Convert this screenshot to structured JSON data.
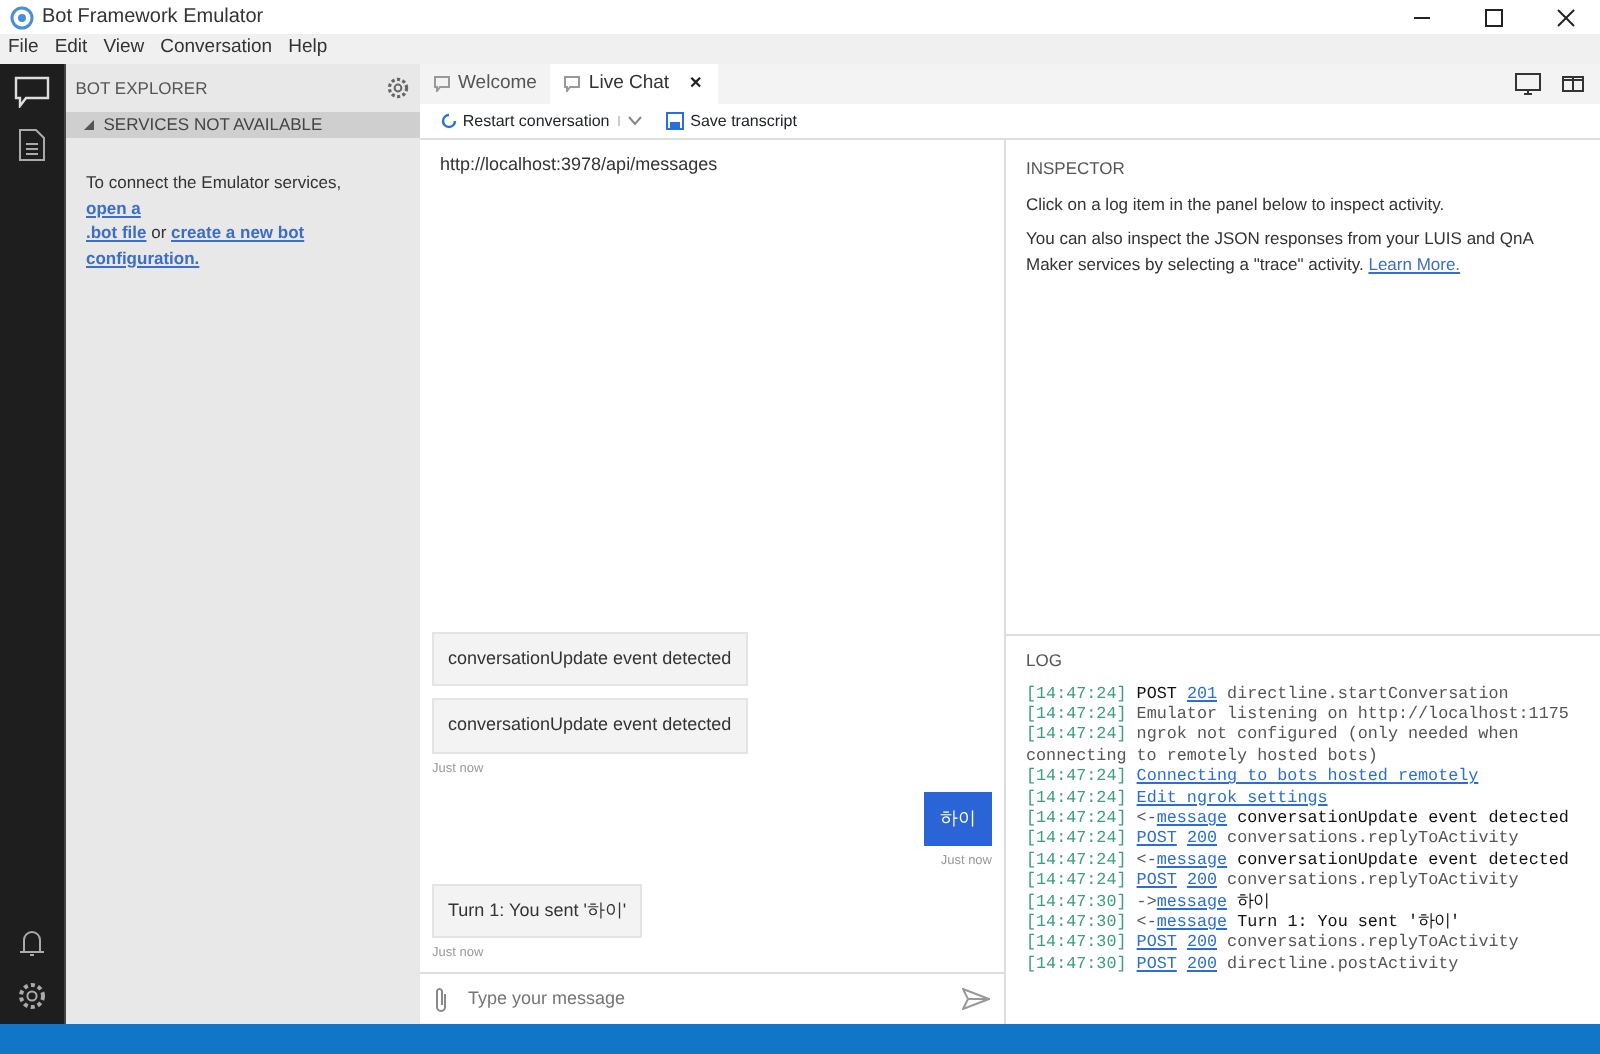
{
  "window": {
    "title": "Bot Framework Emulator"
  },
  "menu": [
    "File",
    "Edit",
    "View",
    "Conversation",
    "Help"
  ],
  "explorer": {
    "title": "BOT EXPLORER",
    "section": {
      "label": "SERVICES NOT AVAILABLE",
      "expanded": true
    },
    "message": [
      {
        "kind": "text",
        "text": "To connect the Emulator services, "
      },
      {
        "kind": "link",
        "text": "open a"
      },
      {
        "kind": "break"
      },
      {
        "kind": "link",
        "text": ".bot file"
      },
      {
        "kind": "text",
        "text": " or "
      },
      {
        "kind": "link",
        "text": "create a new bot"
      },
      {
        "kind": "break"
      },
      {
        "kind": "link",
        "text": "configuration."
      }
    ]
  },
  "tabs": [
    {
      "label": "Welcome",
      "selected": false
    },
    {
      "label": "Live Chat",
      "selected": true,
      "close": "✕"
    }
  ],
  "toolbar": {
    "restart": "Restart conversation",
    "save": "Save transcript"
  },
  "chat": {
    "endpoint": "http://localhost:3978/api/messages",
    "messages": [
      {
        "kind": "bot",
        "text": "conversationUpdate event detected"
      },
      {
        "kind": "bot",
        "text": "conversationUpdate event detected",
        "time": "Just now"
      },
      {
        "kind": "user",
        "text": "하이",
        "time": "Just now"
      },
      {
        "kind": "bot",
        "text": "Turn 1: You sent '하이'",
        "time": "Just now"
      }
    ],
    "input": {
      "placeholder": "Type your message"
    }
  },
  "inspector": {
    "title": "INSPECTOR",
    "line1": "Click on a log item in the panel below to inspect activity.",
    "line2": "You can also inspect the JSON responses from your LUIS and QnA Maker services by selecting a \"trace\" activity.",
    "link": "Learn More."
  },
  "log": {
    "title": "LOG",
    "entries": [
      {
        "time": "[14:47:24]",
        "parts": [
          {
            "kind": "strong",
            "text": "POST"
          },
          {
            "kind": "link",
            "text": "201"
          },
          {
            "kind": "plain",
            "text": "directline.startConversation"
          }
        ]
      },
      {
        "time": "[14:47:24]",
        "parts": [
          {
            "kind": "plain",
            "text": "Emulator listening on http://localhost:1175"
          }
        ]
      },
      {
        "time": "[14:47:24]",
        "parts": [
          {
            "kind": "plain",
            "text": "ngrok not configured (only needed when connecting to remotely hosted bots)"
          }
        ]
      },
      {
        "time": "[14:47:24]",
        "parts": [
          {
            "kind": "link",
            "text": "Connecting to bots hosted remotely"
          }
        ]
      },
      {
        "time": "[14:47:24]",
        "parts": [
          {
            "kind": "link",
            "text": "Edit ngrok settings"
          }
        ]
      },
      {
        "time": "[14:47:24]",
        "parts": [
          {
            "kind": "arrow",
            "text": "<-"
          },
          {
            "kind": "link",
            "text": "message"
          },
          {
            "kind": "strong",
            "text": "conversationUpdate event detected"
          }
        ]
      },
      {
        "time": "[14:47:24]",
        "parts": [
          {
            "kind": "link",
            "text": "POST"
          },
          {
            "kind": "link",
            "text": "200"
          },
          {
            "kind": "plain",
            "text": "conversations.replyToActivity"
          }
        ]
      },
      {
        "time": "[14:47:24]",
        "parts": [
          {
            "kind": "arrow",
            "text": "<-"
          },
          {
            "kind": "link",
            "text": "message"
          },
          {
            "kind": "strong",
            "text": "conversationUpdate event detected"
          }
        ]
      },
      {
        "time": "[14:47:24]",
        "parts": [
          {
            "kind": "link",
            "text": "POST"
          },
          {
            "kind": "link",
            "text": "200"
          },
          {
            "kind": "plain",
            "text": "conversations.replyToActivity"
          }
        ]
      },
      {
        "time": "[14:47:30]",
        "parts": [
          {
            "kind": "arrow",
            "text": "->"
          },
          {
            "kind": "link",
            "text": "message"
          },
          {
            "kind": "strong",
            "text": "하이"
          }
        ]
      },
      {
        "time": "[14:47:30]",
        "parts": [
          {
            "kind": "arrow",
            "text": "<-"
          },
          {
            "kind": "link",
            "text": "message"
          },
          {
            "kind": "strong",
            "text": "Turn 1: You sent '하이'"
          }
        ]
      },
      {
        "time": "[14:47:30]",
        "parts": [
          {
            "kind": "link",
            "text": "POST"
          },
          {
            "kind": "link",
            "text": "200"
          },
          {
            "kind": "plain",
            "text": "conversations.replyToActivity"
          }
        ]
      },
      {
        "time": "[14:47:30]",
        "parts": [
          {
            "kind": "link",
            "text": "POST"
          },
          {
            "kind": "link",
            "text": "200"
          },
          {
            "kind": "plain",
            "text": "directline.postActivity"
          }
        ]
      }
    ]
  }
}
